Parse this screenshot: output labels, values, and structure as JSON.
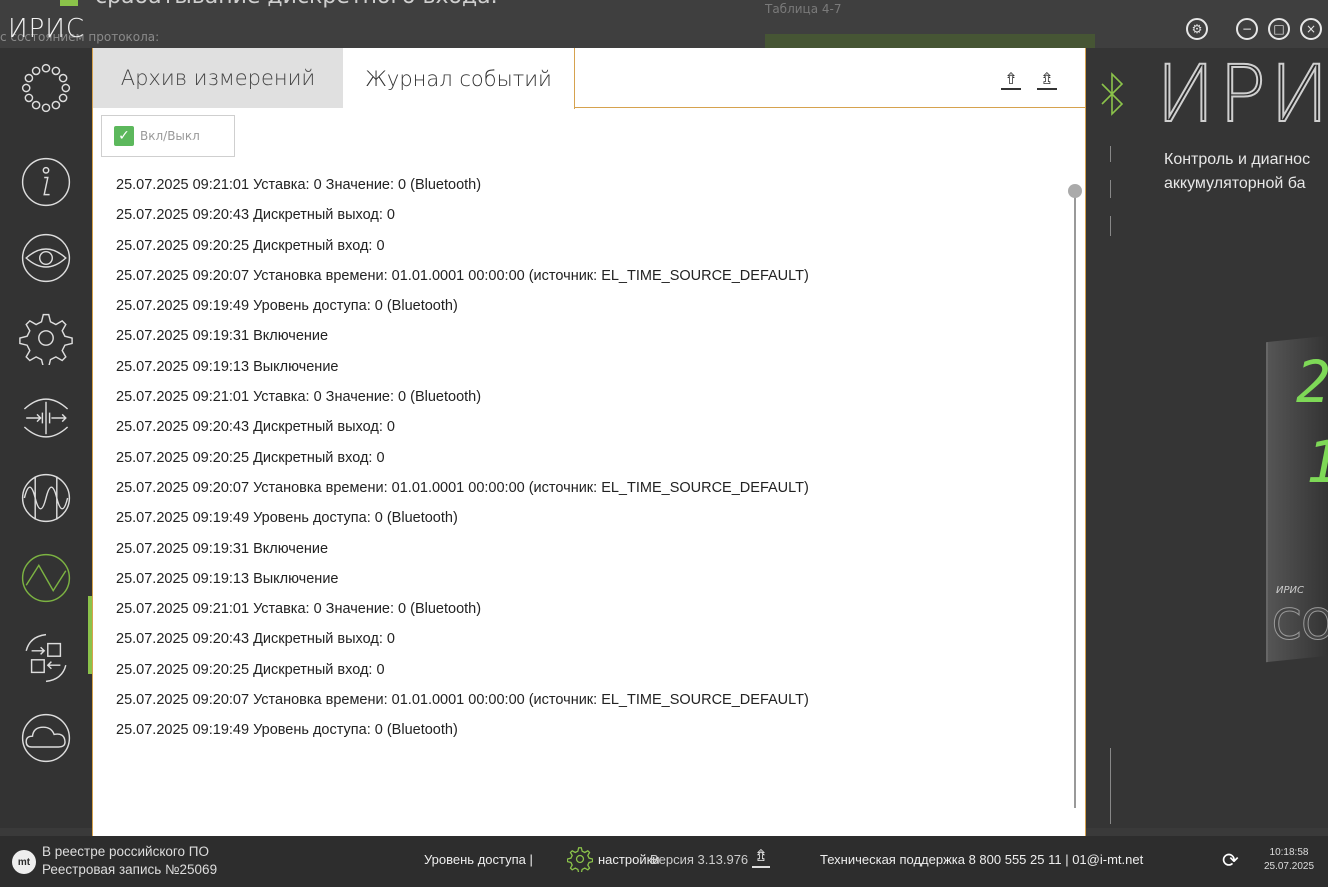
{
  "background": {
    "doc_line": "срабатывание дискретного входа.",
    "doc_sub": "с состоянием протокола:",
    "table_caption": "Таблица 4-7"
  },
  "app": {
    "title": "ИРИС"
  },
  "window_controls": [
    "settings",
    "minimize",
    "maximize",
    "close"
  ],
  "nav": {
    "items": [
      {
        "name": "modules-icon"
      },
      {
        "name": "info-icon"
      },
      {
        "name": "eye-icon"
      },
      {
        "name": "settings-icon"
      },
      {
        "name": "io-icon"
      },
      {
        "name": "signal-icon"
      },
      {
        "name": "oscilloscope-icon"
      },
      {
        "name": "transfer-icon"
      },
      {
        "name": "cloud-icon"
      }
    ],
    "active": "oscilloscope-icon"
  },
  "tabs": {
    "archive": "Архив измерений",
    "journal": "Журнал событий",
    "active": "journal"
  },
  "toggle": {
    "label": "Вкл/Выкл",
    "checked": true
  },
  "events": [
    "25.07.2025 09:21:01 Уставка: 0 Значение: 0 (Bluetooth)",
    "25.07.2025 09:20:43 Дискретный выход: 0",
    "25.07.2025 09:20:25 Дискретный вход: 0",
    "25.07.2025 09:20:07 Установка времени: 01.01.0001 00:00:00 (источник: EL_TIME_SOURCE_DEFAULT)",
    "25.07.2025 09:19:49 Уровень доступа: 0 (Bluetooth)",
    "25.07.2025 09:19:31 Включение",
    "25.07.2025 09:19:13 Выключение",
    "25.07.2025 09:21:01 Уставка: 0 Значение: 0 (Bluetooth)",
    "25.07.2025 09:20:43 Дискретный выход: 0",
    "25.07.2025 09:20:25 Дискретный вход: 0",
    "25.07.2025 09:20:07 Установка времени: 01.01.0001 00:00:00 (источник: EL_TIME_SOURCE_DEFAULT)",
    "25.07.2025 09:19:49 Уровень доступа: 0 (Bluetooth)",
    "25.07.2025 09:19:31 Включение",
    "25.07.2025 09:19:13 Выключение",
    "25.07.2025 09:21:01 Уставка: 0 Значение: 0 (Bluetooth)",
    "25.07.2025 09:20:43 Дискретный выход: 0",
    "25.07.2025 09:20:25 Дискретный вход: 0",
    "25.07.2025 09:20:07 Установка времени: 01.01.0001 00:00:00 (источник: EL_TIME_SOURCE_DEFAULT)",
    "25.07.2025 09:19:49 Уровень доступа: 0 (Bluetooth)"
  ],
  "right_panel": {
    "logo": "ИРИС",
    "description_line1": "Контроль и диагнос",
    "description_line2": "аккумуляторной ба",
    "device_logo": "ИРИС",
    "device_label": "СО"
  },
  "status": {
    "registry_line1": "В реестре российского ПО",
    "registry_line2": "Реестровая запись №25069",
    "access_level": "Уровень доступа |",
    "settings_label": "настройки",
    "version": "Версия 3.13.976",
    "support": "Техническая поддержка  8 800 555 25 11 | 01@i-mt.net",
    "time": "10:18:58",
    "date": "25.07.2025"
  },
  "colors": {
    "accent_green": "#8bc34a",
    "panel_border": "#d6a24e",
    "segment_green": "#7ed957"
  }
}
